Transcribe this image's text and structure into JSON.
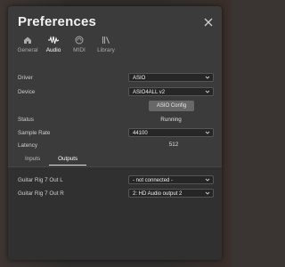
{
  "dialog": {
    "title": "Preferences"
  },
  "tabs": [
    {
      "label": "General",
      "icon": "home-icon"
    },
    {
      "label": "Audio",
      "icon": "audio-wave-icon"
    },
    {
      "label": "MIDI",
      "icon": "midi-icon"
    },
    {
      "label": "Library",
      "icon": "library-icon"
    }
  ],
  "audio": {
    "driver_label": "Driver",
    "driver_value": "ASIO",
    "device_label": "Device",
    "device_value": "ASIO4ALL v2",
    "asio_config_label": "ASIO Config",
    "status_label": "Status",
    "status_value": "Running",
    "sample_rate_label": "Sample Rate",
    "sample_rate_value": "44100",
    "latency_label": "Latency",
    "latency_value": "512"
  },
  "routing_tabs": [
    {
      "label": "Inputs"
    },
    {
      "label": "Outputs"
    }
  ],
  "outputs": [
    {
      "name": "Guitar Rig 7 Out L",
      "value": "- not connected -"
    },
    {
      "name": "Guitar Rig 7 Out R",
      "value": "2: HD Audio output 2"
    }
  ],
  "colors": {
    "dialog_bg": "#3b3b3b",
    "panel_bg": "#303030",
    "select_bg": "#262626",
    "button_bg": "#686868"
  }
}
